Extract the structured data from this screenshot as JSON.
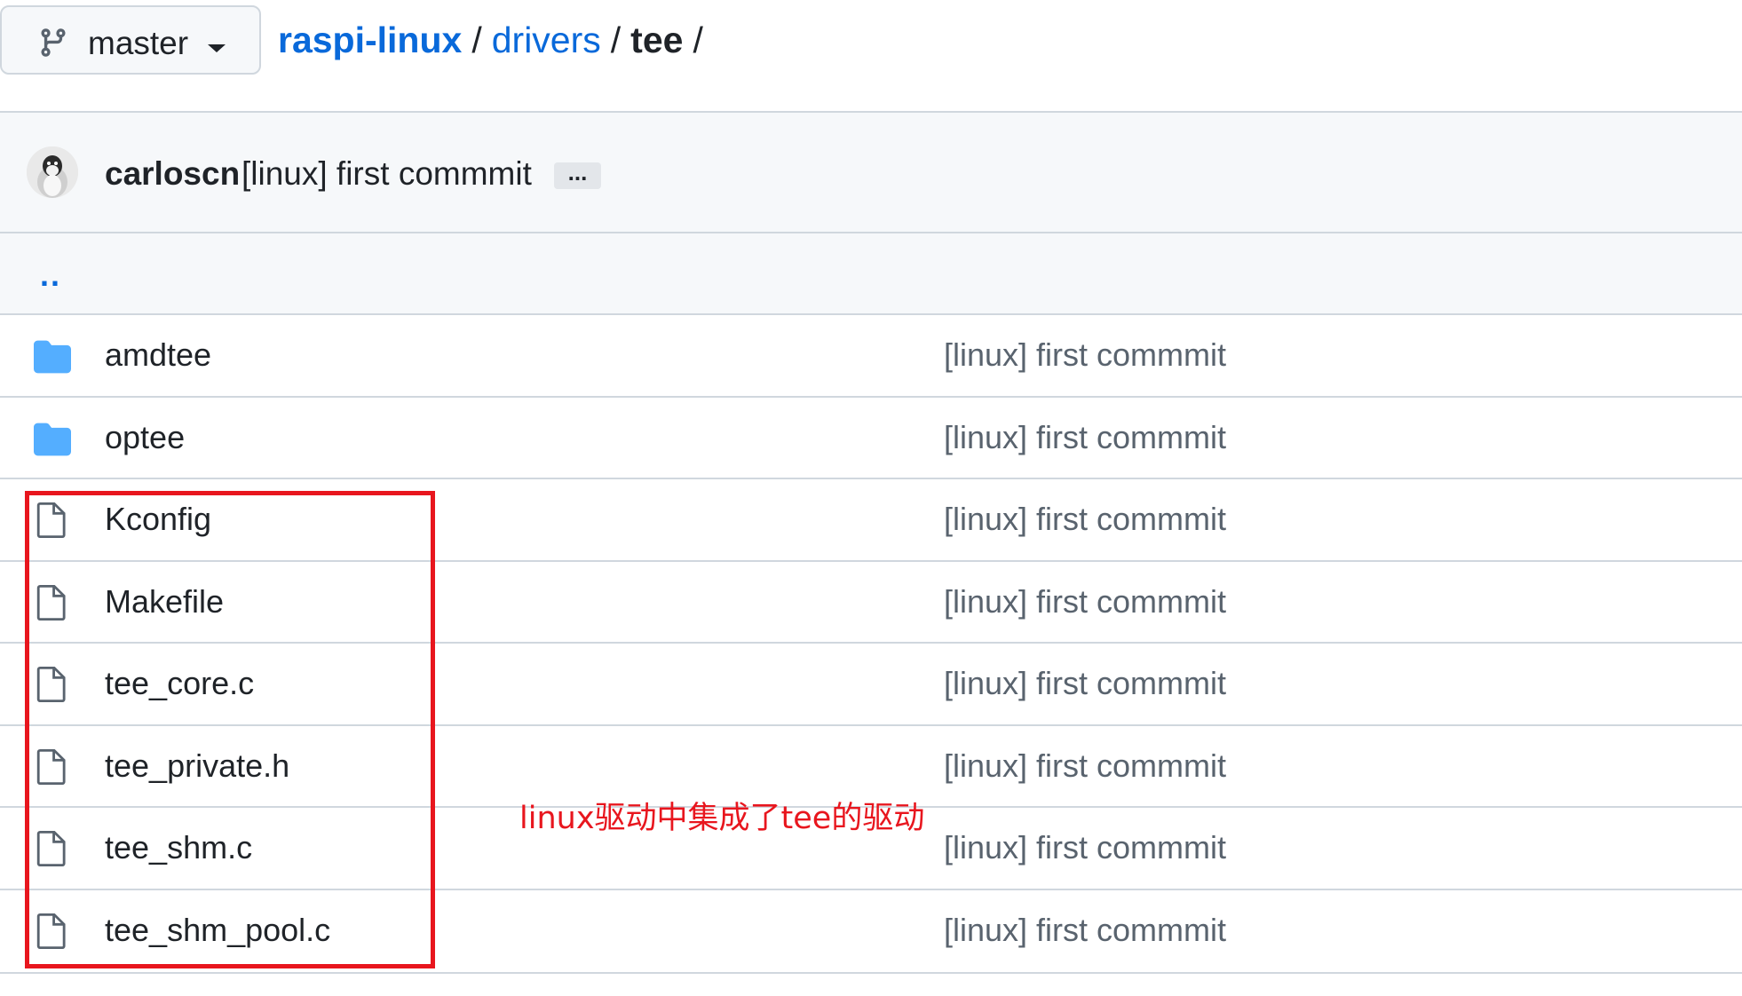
{
  "branch": {
    "name": "master",
    "icon": "git-branch-icon"
  },
  "breadcrumb": {
    "repo": "raspi-linux",
    "sep": "/",
    "folder": "drivers",
    "current": "tee",
    "trailing": "/"
  },
  "commit": {
    "author": "carloscn",
    "message": "[linux] first commmit",
    "more": "..."
  },
  "parent": {
    "label": ".."
  },
  "files": [
    {
      "type": "folder",
      "icon": "folder-icon",
      "name": "amdtee",
      "message": "[linux] first commmit"
    },
    {
      "type": "folder",
      "icon": "folder-icon",
      "name": "optee",
      "message": "[linux] first commmit"
    },
    {
      "type": "file",
      "icon": "file-icon",
      "name": "Kconfig",
      "message": "[linux] first commmit"
    },
    {
      "type": "file",
      "icon": "file-icon",
      "name": "Makefile",
      "message": "[linux] first commmit"
    },
    {
      "type": "file",
      "icon": "file-icon",
      "name": "tee_core.c",
      "message": "[linux] first commmit"
    },
    {
      "type": "file",
      "icon": "file-icon",
      "name": "tee_private.h",
      "message": "[linux] first commmit"
    },
    {
      "type": "file",
      "icon": "file-icon",
      "name": "tee_shm.c",
      "message": "[linux] first commmit"
    },
    {
      "type": "file",
      "icon": "file-icon",
      "name": "tee_shm_pool.c",
      "message": "[linux] first commmit"
    }
  ],
  "annotation": {
    "text": "linux驱动中集成了tee的驱动",
    "color": "#e8161e"
  },
  "colors": {
    "link": "#0969da",
    "folder": "#54aeff",
    "border": "#d0d7de",
    "header_bg": "#f6f8fa"
  }
}
